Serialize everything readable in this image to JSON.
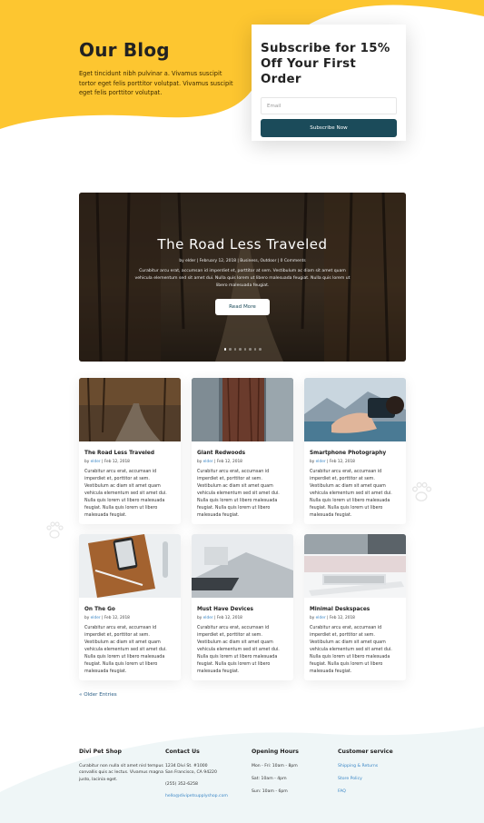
{
  "colors": {
    "accent": "#fdc630",
    "button": "#1b4b5a",
    "link": "#3b87c6",
    "footer_bg": "#eff6f7"
  },
  "hero": {
    "title": "Our Blog",
    "text": "Eget tincidunt nibh pulvinar a. Vivamus suscipit tortor eget felis porttitor volutpat. Vivamus suscipit  eget felis porttitor volutpat."
  },
  "subscribe": {
    "title": "Subscribe for 15% Off Your First Order",
    "email_placeholder": "Email",
    "button": "Subscribe Now"
  },
  "slider": {
    "title": "The Road Less Traveled",
    "meta": "by elder | February 12, 2018 | Business, Outdoor | 0 Comments",
    "text": "Curabitur arcu erat, accumsan id imperdiet et, porttitor at sem. Vestibulum ac diam sit amet quam vehicula elementum sed sit amet dui. Nulla quis lorem ut libero malesuada feugiat. Nulla quis lorem ut libero malesuada feugiat.",
    "button": "Read More",
    "slide_count": 8,
    "active_slide": 1
  },
  "posts": [
    {
      "title": "The Road Less Traveled",
      "author": "elder",
      "date": "Feb 12, 2018",
      "image": "forest-path",
      "text": "Curabitur arcu erat, accumsan id imperdiet et, porttitor at sem. Vestibulum ac diam sit amet quam vehicula elementum sed sit amet dui. Nulla quis lorem ut libero malesuada feugiat. Nulla quis lorem ut libero malesuada feugiat."
    },
    {
      "title": "Giant Redwoods",
      "author": "elder",
      "date": "Feb 12, 2018",
      "image": "redwood-trunk",
      "text": "Curabitur arcu erat, accumsan id imperdiet et, porttitor at sem. Vestibulum ac diam sit amet quam vehicula elementum sed sit amet dui. Nulla quis lorem ut libero malesuada feugiat. Nulla quis lorem ut libero malesuada feugiat."
    },
    {
      "title": "Smartphone Photography",
      "author": "elder",
      "date": "Feb 12, 2018",
      "image": "hand-phone-mountains",
      "text": "Curabitur arcu erat, accumsan id imperdiet et, porttitor at sem. Vestibulum ac diam sit amet quam vehicula elementum sed sit amet dui. Nulla quis lorem ut libero malesuada feugiat. Nulla quis lorem ut libero malesuada feugiat."
    },
    {
      "title": "On The Go",
      "author": "elder",
      "date": "Feb 12, 2018",
      "image": "phone-on-leather",
      "text": "Curabitur arcu erat, accumsan id imperdiet et, porttitor at sem. Vestibulum ac diam sit amet quam vehicula elementum sed sit amet dui. Nulla quis lorem ut libero malesuada feugiat. Nulla quis lorem ut libero malesuada feugiat."
    },
    {
      "title": "Must Have Devices",
      "author": "elder",
      "date": "Feb 12, 2018",
      "image": "laptop-keyboard",
      "text": "Curabitur arcu erat, accumsan id imperdiet et, porttitor at sem. Vestibulum ac diam sit amet quam vehicula elementum sed sit amet dui. Nulla quis lorem ut libero malesuada feugiat. Nulla quis lorem ut libero malesuada feugiat."
    },
    {
      "title": "Minimal Deskspaces",
      "author": "elder",
      "date": "Feb 12, 2018",
      "image": "desk-keyboard",
      "text": "Curabitur arcu erat, accumsan id imperdiet et, porttitor at sem. Vestibulum ac diam sit amet quam vehicula elementum sed sit amet dui. Nulla quis lorem ut libero malesuada feugiat. Nulla quis lorem ut libero malesuada feugiat."
    }
  ],
  "pagination": {
    "older": "« Older Entries"
  },
  "footer": {
    "shop": {
      "title": "Divi Pet Shop",
      "text": "Curabitur non nulla sit amet nisl tempus convallis quis ac lectus. Vivamus magna justo, lacinia eget."
    },
    "contact": {
      "title": "Contact Us",
      "address1": "1234 Divi St. #1000",
      "address2": "San Francisco, CA 94220",
      "phone": "(255) 352-6258",
      "email": "hello@divipetsupplyshop.com"
    },
    "hours": {
      "title": "Opening Hours",
      "rows": [
        "Mon - Fri: 10am - 8pm",
        "Sat: 10am - 4pm",
        "Sun: 10am - 6pm"
      ]
    },
    "service": {
      "title": "Customer service",
      "links": [
        "Shipping & Returns",
        "Store Policy",
        "FAQ"
      ]
    }
  }
}
